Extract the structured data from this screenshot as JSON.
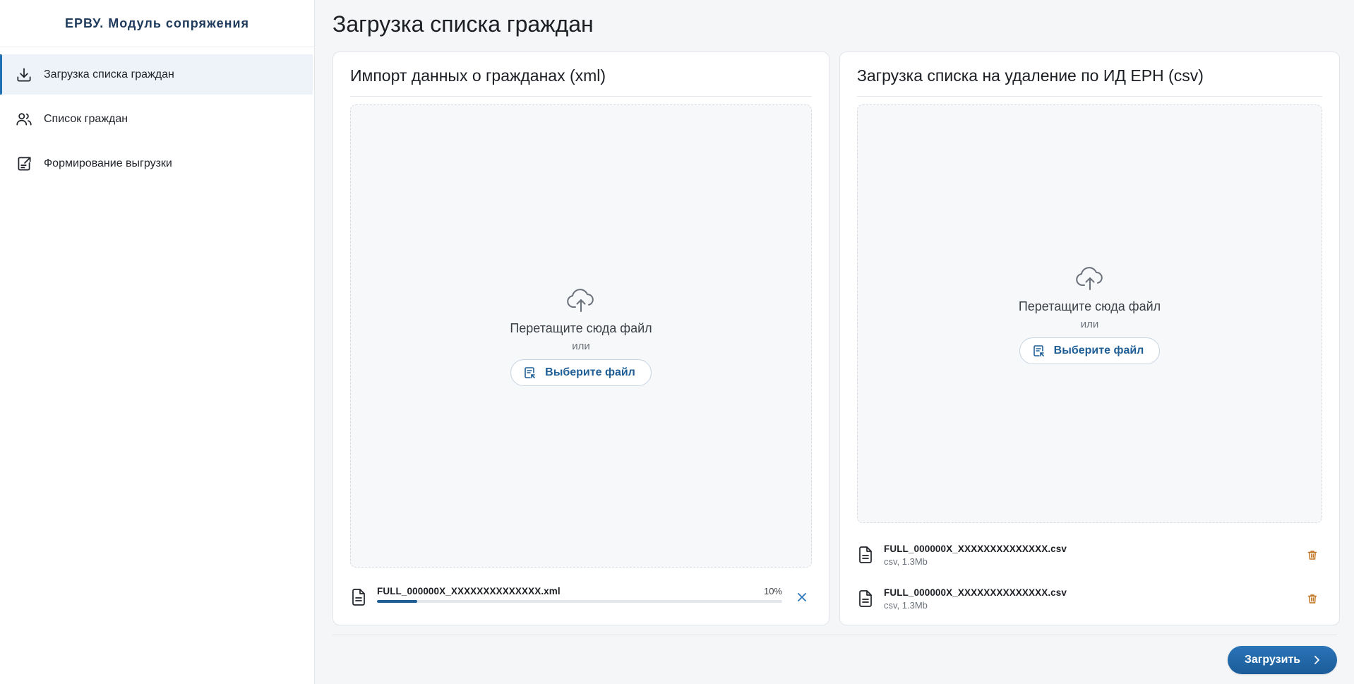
{
  "app": {
    "brand": "ЕРВУ. Модуль сопряжения"
  },
  "sidebar": {
    "items": [
      {
        "label": "Загрузка списка граждан",
        "icon": "download-icon",
        "active": true
      },
      {
        "label": "Список граждан",
        "icon": "users-icon",
        "active": false
      },
      {
        "label": "Формирование выгрузки",
        "icon": "document-export-icon",
        "active": false
      }
    ]
  },
  "page": {
    "title": "Загрузка списка граждан"
  },
  "import_card": {
    "title": "Импорт данных о гражданах (xml)",
    "dropzone": {
      "text": "Перетащите сюда файл",
      "or": "или",
      "button": "Выберите файл"
    },
    "file": {
      "name": "FULL_000000X_XXXXXXXXXXXXXX.xml",
      "progress_percent": 10,
      "progress_label": "10%"
    }
  },
  "delete_card": {
    "title": "Загрузка списка на удаление по ИД ЕРН (csv)",
    "dropzone": {
      "text": "Перетащите сюда файл",
      "or": "или",
      "button": "Выберите файл"
    },
    "files": [
      {
        "name": "FULL_000000X_XXXXXXXXXXXXXX.csv",
        "meta": "csv, 1.3Mb"
      },
      {
        "name": "FULL_000000X_XXXXXXXXXXXXXX.csv",
        "meta": "csv, 1.3Mb"
      }
    ]
  },
  "footer": {
    "submit": "Загрузить"
  },
  "colors": {
    "accent": "#1f5f96",
    "trash": "#c0741f",
    "close": "#2a74b8"
  }
}
